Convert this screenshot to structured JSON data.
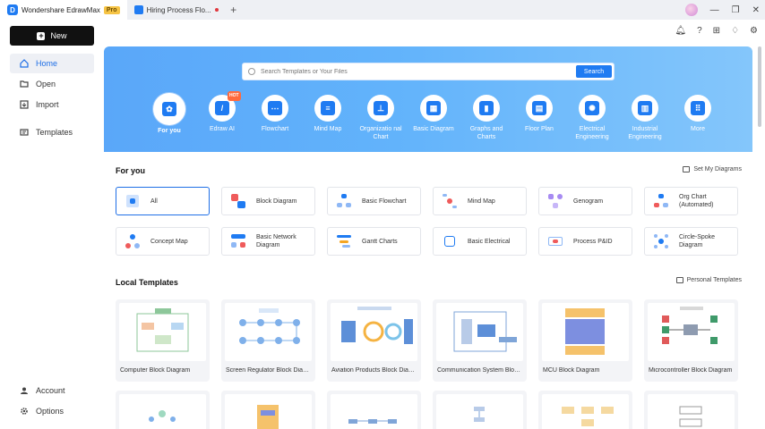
{
  "titlebar": {
    "app_name": "Wondershare EdrawMax",
    "pro_badge": "Pro",
    "document_tab": "Hiring Process Flo...",
    "new_tab": "+"
  },
  "sidebar": {
    "new_label": "New",
    "items": [
      {
        "label": "Home",
        "icon": "home-icon",
        "active": true
      },
      {
        "label": "Open",
        "icon": "folder-icon",
        "active": false
      },
      {
        "label": "Import",
        "icon": "import-icon",
        "active": false
      },
      {
        "label": "Templates",
        "icon": "templates-icon",
        "active": false
      }
    ],
    "bottom_items": [
      {
        "label": "Account",
        "icon": "account-icon"
      },
      {
        "label": "Options",
        "icon": "gear-icon"
      }
    ]
  },
  "search": {
    "placeholder": "Search Templates or Your Files",
    "button": "Search"
  },
  "categories": [
    {
      "label": "For you",
      "selected": true
    },
    {
      "label": "Edraw AI",
      "badge": "HOT"
    },
    {
      "label": "Flowchart"
    },
    {
      "label": "Mind Map"
    },
    {
      "label": "Organizatio nal Chart"
    },
    {
      "label": "Basic Diagram"
    },
    {
      "label": "Graphs and Charts"
    },
    {
      "label": "Floor Plan"
    },
    {
      "label": "Electrical Engineering"
    },
    {
      "label": "Industrial Engineering"
    },
    {
      "label": "More"
    }
  ],
  "for_you": {
    "title": "For you",
    "link": "Set My Diagrams",
    "items": [
      {
        "label": "All",
        "selected": true
      },
      {
        "label": "Block Diagram"
      },
      {
        "label": "Basic Flowchart"
      },
      {
        "label": "Mind Map"
      },
      {
        "label": "Genogram"
      },
      {
        "label": "Org Chart (Automated)"
      },
      {
        "label": "Concept Map"
      },
      {
        "label": "Basic Network Diagram"
      },
      {
        "label": "Gantt Charts"
      },
      {
        "label": "Basic Electrical"
      },
      {
        "label": "Process P&ID"
      },
      {
        "label": "Circle-Spoke Diagram"
      }
    ]
  },
  "local_templates": {
    "title": "Local Templates",
    "link": "Personal Templates",
    "items": [
      {
        "label": "Computer Block Diagram"
      },
      {
        "label": "Screen Regulator Block Diagram"
      },
      {
        "label": "Aviation Products Block Diagr..."
      },
      {
        "label": "Communication System Block ..."
      },
      {
        "label": "MCU Block Diagram"
      },
      {
        "label": "Microcontroller Block Diagram"
      }
    ]
  },
  "colors": {
    "accent": "#1f7bf2",
    "hero_start": "#5aa7f9",
    "hero_end": "#84c6fb"
  }
}
